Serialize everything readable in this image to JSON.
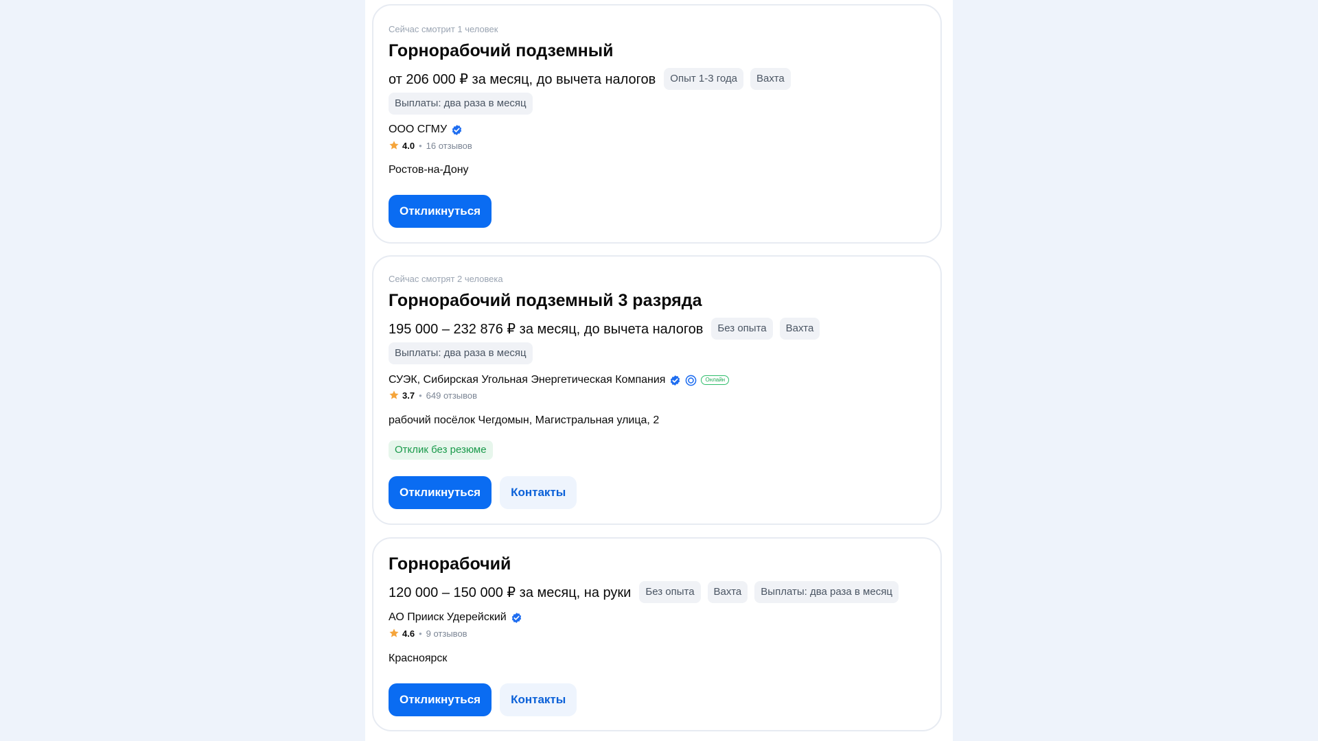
{
  "colors": {
    "page_background": "#eef3fb",
    "primary_button": "#0a6cf2",
    "verified_badge": "#1e6df0",
    "star": "#f5a43a",
    "online_badge": "#2dbd6a",
    "no_resume_tag_bg": "#e7f6ec"
  },
  "vacancies": [
    {
      "viewers": "Сейчас смотрит 1 человек",
      "title": "Горнорабочий подземный",
      "salary": "от 206 000 ₽ за месяц, до вычета налогов",
      "tags": [
        "Опыт 1-3 года",
        "Вахта"
      ],
      "payout_tag": "Выплаты: два раза в месяц",
      "company": "ООО СГМУ",
      "verified": true,
      "rating": "4.0",
      "reviews": "16 отзывов",
      "location": "Ростов-на-Дону",
      "apply_label": "Откликнуться",
      "icons": [
        "verified-icon",
        "star-icon"
      ]
    },
    {
      "viewers": "Сейчас смотрят 2 человека",
      "title": "Горнорабочий подземный 3 разряда",
      "salary": "195 000 – 232 876 ₽ за месяц, до вычета налогов",
      "tags": [
        "Без опыта",
        "Вахта"
      ],
      "payout_tag": "Выплаты: два раза в месяц",
      "company": "СУЭК, Сибирская Угольная Энергетическая Компания",
      "verified": true,
      "online_badge": "Онлайн",
      "rating": "3.7",
      "reviews": "649 отзывов",
      "location": "рабочий посёлок Чегдомын, Магистральная улица, 2",
      "no_resume_tag": "Отклик без резюме",
      "apply_label": "Откликнуться",
      "contacts_label": "Контакты",
      "icons": [
        "verified-icon",
        "accredited-it-icon",
        "star-icon"
      ]
    },
    {
      "title": "Горнорабочий",
      "salary": "120 000 – 150 000 ₽ за месяц, на руки",
      "tags": [
        "Без опыта",
        "Вахта",
        "Выплаты: два раза в месяц"
      ],
      "company": "АО Прииск Удерейский",
      "verified": true,
      "rating": "4.6",
      "reviews": "9 отзывов",
      "location": "Красноярск",
      "apply_label": "Откликнуться",
      "contacts_label": "Контакты",
      "icons": [
        "verified-icon",
        "star-icon"
      ]
    }
  ]
}
